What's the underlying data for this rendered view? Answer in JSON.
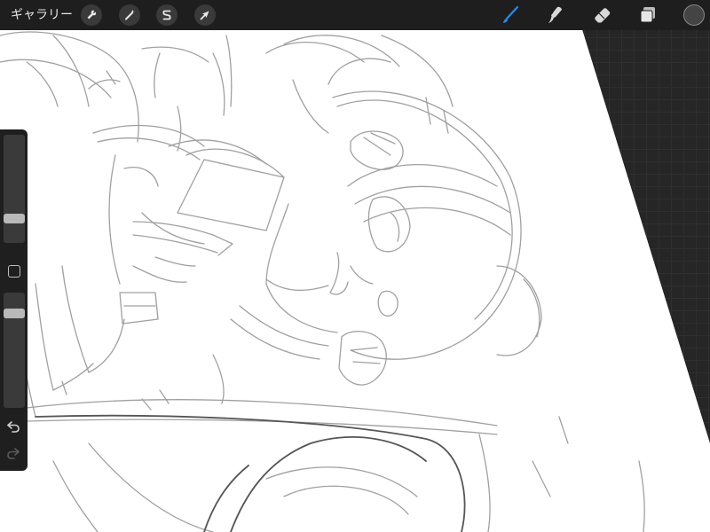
{
  "toolbar": {
    "gallery_label": "ギャラリー",
    "left_tools": [
      {
        "icon": "wrench-icon",
        "name": "actions"
      },
      {
        "icon": "magic-wand-icon",
        "name": "adjustments"
      },
      {
        "icon": "selection-icon",
        "name": "selection"
      },
      {
        "icon": "arrow-cursor-icon",
        "name": "transform"
      }
    ],
    "right_tools": [
      {
        "icon": "brush-icon",
        "name": "brush",
        "active": true
      },
      {
        "icon": "smudge-icon",
        "name": "smudge",
        "active": false
      },
      {
        "icon": "eraser-icon",
        "name": "eraser",
        "active": false
      },
      {
        "icon": "layers-icon",
        "name": "layers",
        "active": false
      }
    ],
    "current_color": "#444444"
  },
  "sidebar": {
    "brush_size_level": 0.2,
    "opacity_level": 0.85,
    "undo_icon": "undo-icon",
    "redo_icon": "redo-icon"
  },
  "colors": {
    "accent": "#1e8cff",
    "workspace": "#262626",
    "canvas": "#ffffff",
    "sketch_stroke": "#9a9a9a"
  }
}
